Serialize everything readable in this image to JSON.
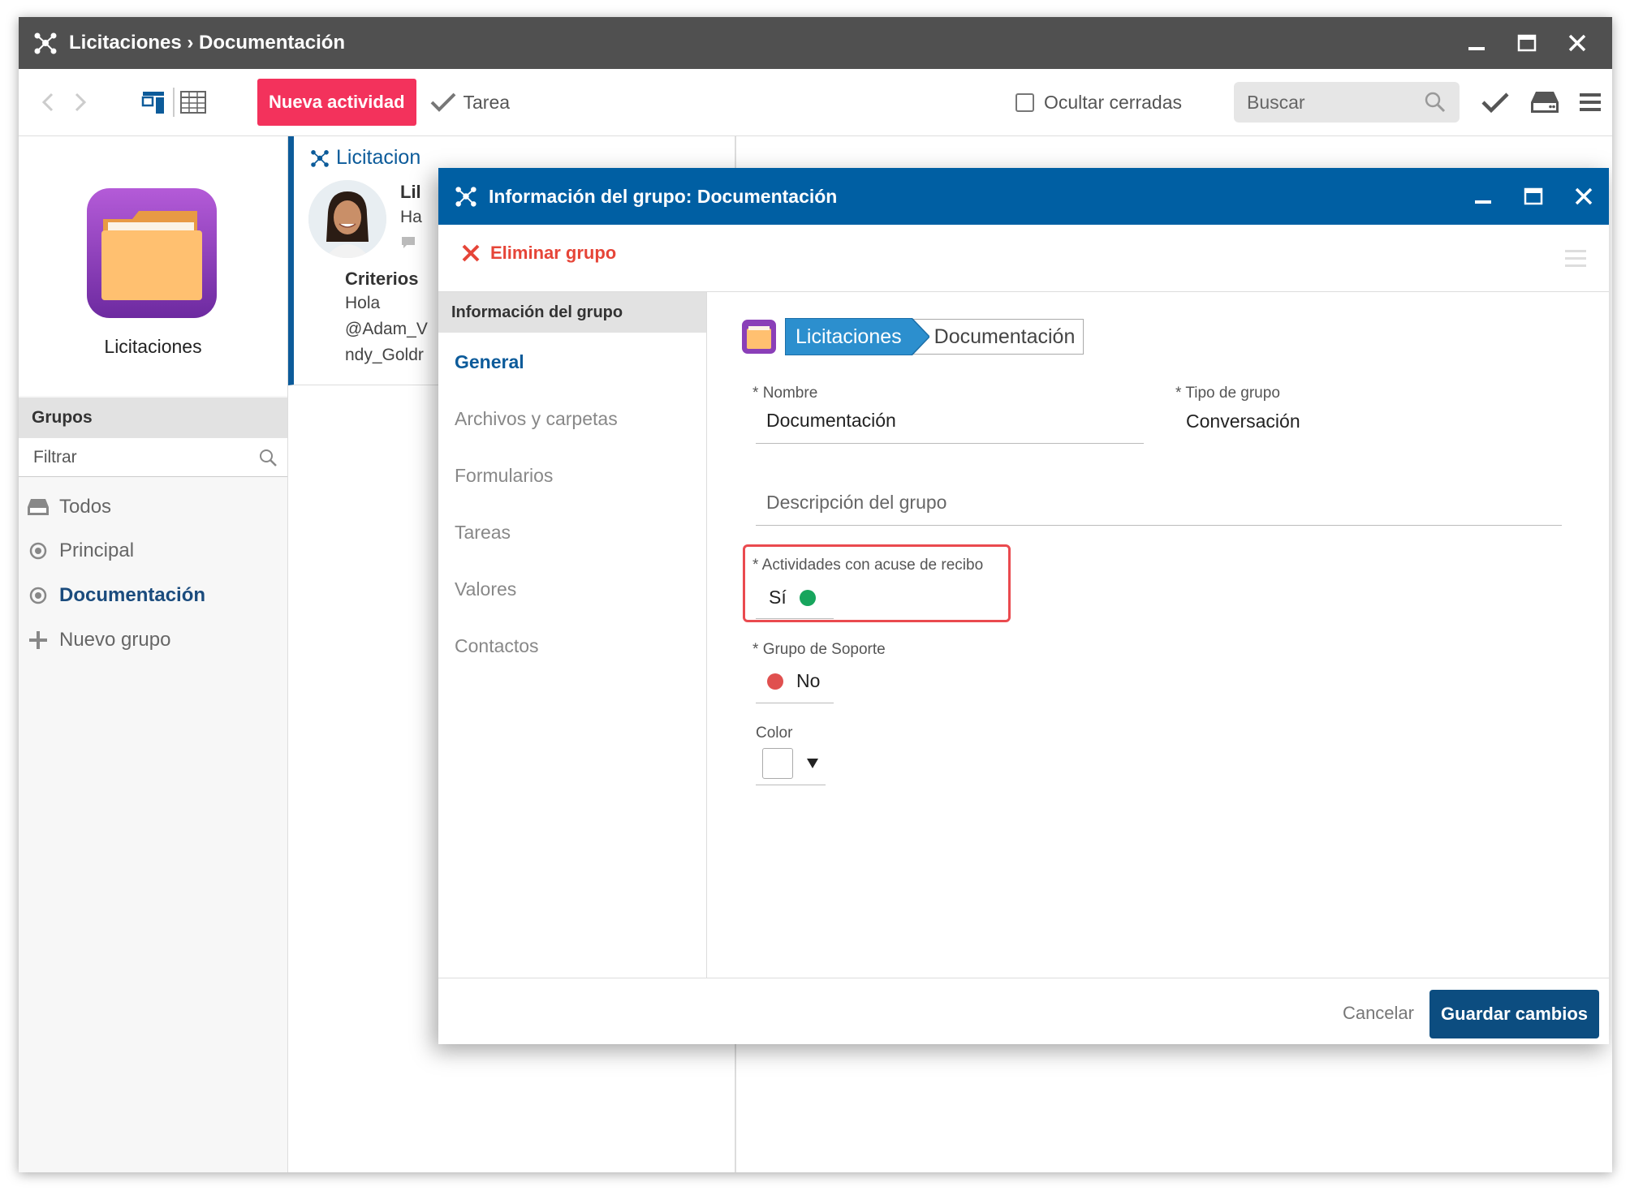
{
  "window": {
    "title": "Licitaciones › Documentación"
  },
  "toolbar": {
    "new_activity": "Nueva actividad",
    "task": "Tarea",
    "hide_closed": "Ocultar cerradas",
    "search_placeholder": "Buscar"
  },
  "sidebar": {
    "project_name": "Licitaciones",
    "groups_header": "Grupos",
    "filter_placeholder": "Filtrar",
    "items": [
      {
        "label": "Todos"
      },
      {
        "label": "Principal"
      },
      {
        "label": "Documentación"
      },
      {
        "label": "Nuevo grupo"
      }
    ]
  },
  "feed": {
    "title": "Licitacion",
    "author_partial": "Lil",
    "line_partial": "Ha",
    "heading": "Criterios",
    "body": [
      "Hola",
      "@Adam_V",
      "ndy_Goldr"
    ]
  },
  "dialog": {
    "title": "Información del grupo: Documentación",
    "delete_label": "Eliminar grupo",
    "section_header": "Información del grupo",
    "nav": [
      {
        "label": "General"
      },
      {
        "label": "Archivos y carpetas"
      },
      {
        "label": "Formularios"
      },
      {
        "label": "Tareas"
      },
      {
        "label": "Valores"
      },
      {
        "label": "Contactos"
      }
    ],
    "breadcrumb": {
      "parent": "Licitaciones",
      "current": "Documentación"
    },
    "fields": {
      "name_label": "Nombre",
      "name_value": "Documentación",
      "type_label": "Tipo de grupo",
      "type_value": "Conversación",
      "description_placeholder": "Descripción del grupo",
      "ack_label": "Actividades con acuse de recibo",
      "ack_value": "Sí",
      "support_label": "Grupo de Soporte",
      "support_value": "No",
      "color_label": "Color",
      "required_mark": "*"
    },
    "cancel": "Cancelar",
    "save": "Guardar cambios"
  },
  "colors": {
    "title_bar": "#505050",
    "dialog_header": "#005fa3",
    "accent_pink": "#f3325c",
    "nav_active": "#0c5b9a",
    "status_yes": "#17a55d",
    "status_no": "#e0504f",
    "highlight": "#ea4a4f",
    "save_button": "#0c4d80"
  }
}
